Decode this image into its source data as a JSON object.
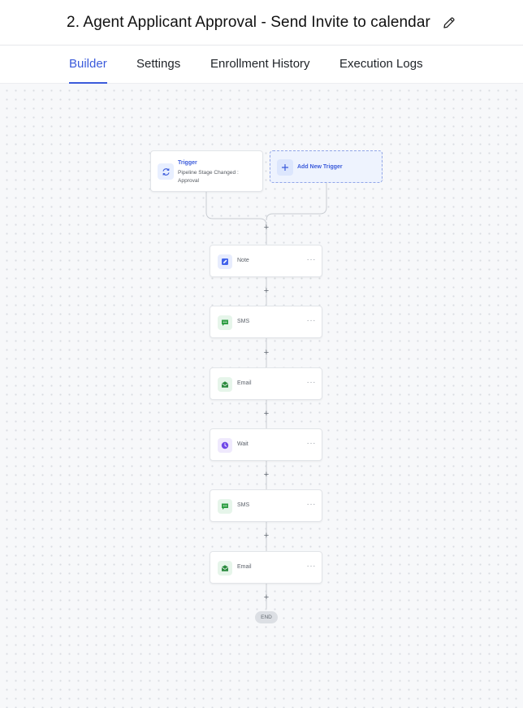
{
  "header": {
    "title": "2. Agent Applicant Approval - Send Invite to calendar",
    "edit_icon": "pencil-icon"
  },
  "tabs": [
    {
      "label": "Builder",
      "active": true
    },
    {
      "label": "Settings",
      "active": false
    },
    {
      "label": "Enrollment History",
      "active": false
    },
    {
      "label": "Execution Logs",
      "active": false
    }
  ],
  "trigger": {
    "title": "Trigger",
    "subtitle": "Pipeline Stage Changed : Approval",
    "icon": "refresh-icon"
  },
  "add_trigger": {
    "label": "Add New Trigger",
    "icon": "plus-icon"
  },
  "steps": [
    {
      "label": "Note",
      "icon": "note-icon",
      "color": "#4263eb",
      "bg": "#e7ecfd"
    },
    {
      "label": "SMS",
      "icon": "chat-icon",
      "color": "#2f9e44",
      "bg": "#e6f5ea"
    },
    {
      "label": "Email",
      "icon": "envelope-icon",
      "color": "#2b8a3e",
      "bg": "#e6f5ea"
    },
    {
      "label": "Wait",
      "icon": "clock-icon",
      "color": "#7048e8",
      "bg": "#efe9fd"
    },
    {
      "label": "SMS",
      "icon": "chat-icon",
      "color": "#2f9e44",
      "bg": "#e6f5ea"
    },
    {
      "label": "Email",
      "icon": "envelope-icon",
      "color": "#2b8a3e",
      "bg": "#e6f5ea"
    }
  ],
  "step_menu": "···",
  "add_step": "+",
  "end_label": "END",
  "colors": {
    "accent": "#3b5bdb",
    "connector": "#c9cdd3"
  }
}
